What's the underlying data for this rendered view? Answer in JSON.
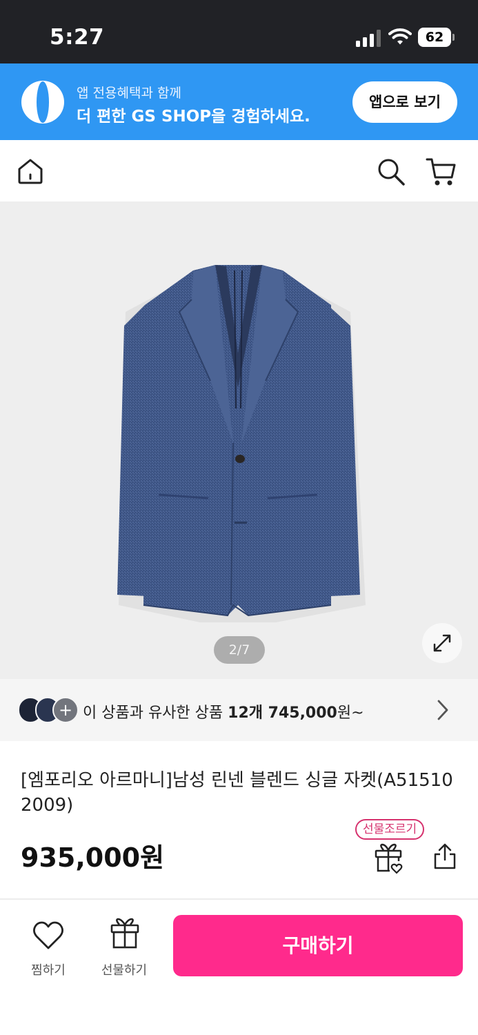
{
  "status_bar": {
    "time": "5:27",
    "battery": "62"
  },
  "banner": {
    "line1": "앱 전용혜택과 함께",
    "line2": "더 편한 GS SHOP을 경험하세요.",
    "button_label": "앱으로 보기"
  },
  "header": {
    "icons": [
      "home-icon",
      "search-icon",
      "cart-icon"
    ]
  },
  "gallery": {
    "page_indicator": "2/7"
  },
  "similar": {
    "prefix": "이 상품과 유사한 상품 ",
    "count": "12개 745,000",
    "suffix": "원~",
    "plus": "+"
  },
  "product": {
    "title": "[엠포리오 아르마니]남성 린넨 블렌드 싱글 자켓(A51510 2009)",
    "price": "935,000원",
    "gift_tag": "선물조르기"
  },
  "bottom_bar": {
    "wish_label": "찜하기",
    "gift_label": "선물하기",
    "buy_label": "구매하기"
  },
  "colors": {
    "banner_bg": "#2f97f3",
    "buy_button": "#ff2a8c",
    "gift_tag": "#d6326e",
    "status_bar": "#212226"
  }
}
